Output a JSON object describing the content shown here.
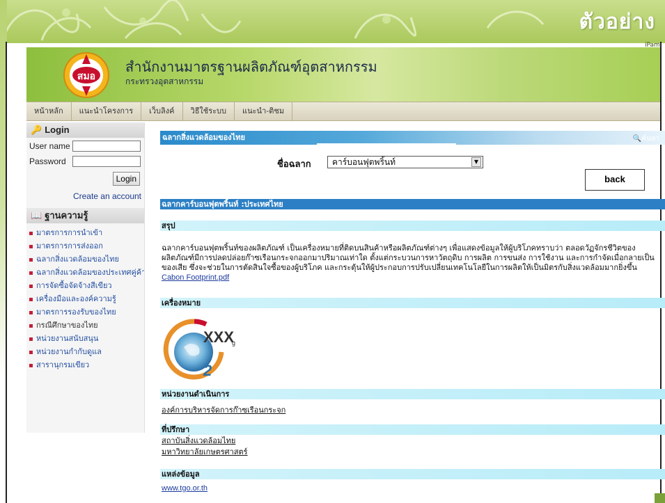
{
  "slide": {
    "title": "ตัวอย่าง",
    "corner_tag": "iPam"
  },
  "site": {
    "logo_text": "สมอ",
    "name": "สำนักงานมาตรฐานผลิตภัณฑ์อุตสาหกรรม",
    "subtitle": "กระทรวงอุตสาหกรรม"
  },
  "nav": {
    "items": [
      "หน้าหลัก",
      "แนะนำโครงการ",
      "เว็บลิงค์",
      "วิธีใช้ระบบ",
      "แนะนำ-ติชม"
    ]
  },
  "login": {
    "title": "Login",
    "username_label": "User name",
    "password_label": "Password",
    "button": "Login",
    "create_account": "Create an account"
  },
  "knowledge": {
    "title": "ฐานความรู้",
    "items": [
      "มาตรการการนำเข้า",
      "มาตรการการส่งออก",
      "ฉลากสิ่งแวดล้อมของไทย",
      "ฉลากสิ่งแวดล้อมของประเทศคู่ค้า",
      "การจัดซื้อจัดจ้างสีเขียว",
      "เครื่องมือและองค์ความรู้",
      "มาตรการรองรับของไทย",
      "กรณีศึกษาของไทย",
      "หน่วยงานสนับสนุน",
      "หน่วยงานกำกับดูแล",
      "สารานุกรมเขียว"
    ]
  },
  "main": {
    "header": "ฉลากสิ่งแวดล้อมของไทย",
    "search_label": "ค้นหา",
    "select_label": "ชื่อฉลาก",
    "select_value": "คาร์บอนฟุตพริ้นท์",
    "back_button": "back",
    "label_title": "ฉลากคาร์บอนฟุตพริ้นท์ :ประเทศไทย",
    "summary_title": "สรุป",
    "summary_text": "ฉลากคาร์บอนฟุตพริ้นท์ของผลิตภัณฑ์ เป็นเครื่องหมายที่ติดบนสินค้าหรือผลิตภัณฑ์ต่างๆ เพื่อแสดงข้อมูลให้ผู้บริโภคทราบว่า ตลอดวัฏจักรชีวิตของผลิตภัณฑ์มีการปลดปล่อยก๊าซเรือนกระจกออกมาปริมาณเท่าใด ตั้งแต่กระบวนการหาวัตถุดิบ การผลิต การขนส่ง การใช้งาน และการกำจัดเมื่อกลายเป็นของเสีย ซึ่งจะช่วยในการตัดสินใจซื้อของผู้บริโภค และกระตุ้นให้ผู้ประกอบการปรับเปลี่ยนเทคโนโลยีในการผลิตให้เป็นมิตรกับสิ่งแวดล้อมมากยิ่งขึ้น",
    "pdf_link": "Cabon Footprint.pdf",
    "mark_title": "เครื่องหมาย",
    "mark_text": "XXX",
    "mark_sub": "g",
    "mark_two": "2",
    "agency_title": "หน่วยงานดำเนินการ",
    "agency": "องค์การบริหารจัดการก๊าซเรือนกระจก",
    "advisor_title": "ที่ปรึกษา",
    "advisors": [
      "สถาบันสิ่งแวดล้อมไทย",
      "มหาวิทยาลัยเกษตรศาสตร์"
    ],
    "source_title": "แหล่งข้อมูล",
    "source_link": "www.tgo.or.th"
  }
}
